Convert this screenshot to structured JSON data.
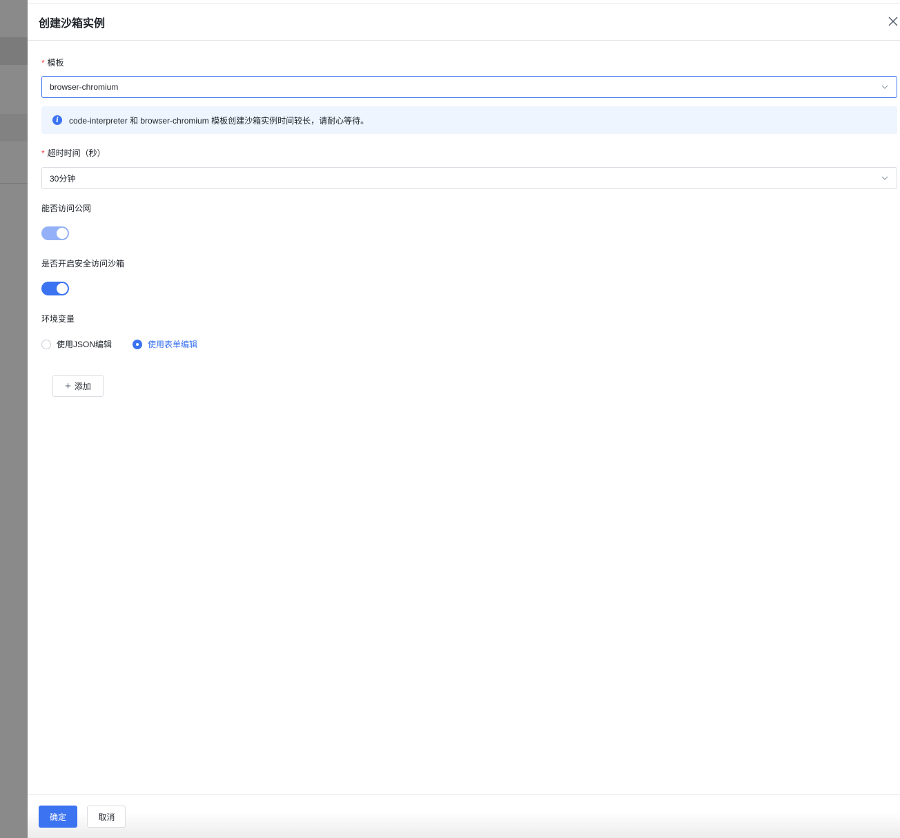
{
  "drawer": {
    "title": "创建沙箱实例"
  },
  "form": {
    "template": {
      "label": "模板",
      "required": "*",
      "value": "browser-chromium"
    },
    "alert": {
      "text": "code-interpreter 和 browser-chromium 模板创建沙箱实例时间较长，请耐心等待。",
      "icon": "i"
    },
    "timeout": {
      "label": "超时时间（秒）",
      "required": "*",
      "value": "30分钟"
    },
    "public_access": {
      "label": "能否访问公网",
      "on": true,
      "disabled": true
    },
    "secure_access": {
      "label": "是否开启安全访问沙箱",
      "on": true
    },
    "env": {
      "label": "环境变量",
      "options": [
        "使用JSON编辑",
        "使用表单编辑"
      ],
      "selected": 1,
      "add_label": "添加"
    }
  },
  "footer": {
    "confirm": "确定",
    "cancel": "取消"
  },
  "colors": {
    "primary": "#3b73f0",
    "disabled_switch": "#94b1f7",
    "required": "#f53f3f"
  }
}
